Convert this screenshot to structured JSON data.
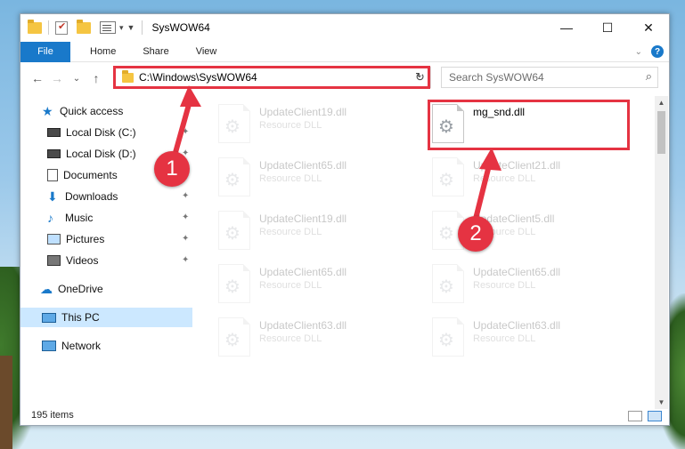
{
  "window": {
    "title": "SysWOW64",
    "controls": {
      "minimize": "—",
      "maximize": "☐",
      "close": "✕"
    }
  },
  "ribbon": {
    "tabs": [
      "File",
      "Home",
      "Share",
      "View"
    ],
    "accent": "#1979ca"
  },
  "nav": {
    "back": "←",
    "forward": "→",
    "recent": "⌄",
    "up": "↑",
    "address": "C:\\Windows\\SysWOW64",
    "search_placeholder": "Search SysWOW64"
  },
  "sidebar": {
    "items": [
      {
        "label": "Quick access",
        "icon": "star-icon"
      },
      {
        "label": "Local Disk (C:)",
        "icon": "disk-icon",
        "pinned": true
      },
      {
        "label": "Local Disk (D:)",
        "icon": "disk-icon",
        "pinned": true
      },
      {
        "label": "Documents",
        "icon": "document-icon",
        "pinned": true
      },
      {
        "label": "Downloads",
        "icon": "download-icon",
        "pinned": true
      },
      {
        "label": "Music",
        "icon": "music-icon",
        "pinned": true
      },
      {
        "label": "Pictures",
        "icon": "pictures-icon",
        "pinned": true
      },
      {
        "label": "Videos",
        "icon": "videos-icon",
        "pinned": true
      },
      {
        "label": "OneDrive",
        "icon": "onedrive-icon"
      },
      {
        "label": "This PC",
        "icon": "this-pc-icon",
        "selected": true
      },
      {
        "label": "Network",
        "icon": "network-icon"
      }
    ]
  },
  "files": [
    {
      "name": "UpdateClient19.dll",
      "type": "Resource DLL",
      "faded": true
    },
    {
      "name": "mg_snd.dll",
      "type": "",
      "faded": false
    },
    {
      "name": "UpdateClient65.dll",
      "type": "Resource DLL",
      "faded": true
    },
    {
      "name": "UpdateClient21.dll",
      "type": "Resource DLL",
      "faded": true
    },
    {
      "name": "UpdateClient19.dll",
      "type": "Resource DLL",
      "faded": true
    },
    {
      "name": "UpdateClient5.dll",
      "type": "Resource DLL",
      "faded": true
    },
    {
      "name": "UpdateClient65.dll",
      "type": "Resource DLL",
      "faded": true
    },
    {
      "name": "UpdateClient65.dll",
      "type": "Resource DLL",
      "faded": true
    },
    {
      "name": "UpdateClient63.dll",
      "type": "Resource DLL",
      "faded": true
    },
    {
      "name": "UpdateClient63.dll",
      "type": "Resource DLL",
      "faded": true
    }
  ],
  "status": {
    "count": "195 items"
  },
  "annotations": {
    "step1": "1",
    "step2": "2",
    "color": "#e53342"
  }
}
